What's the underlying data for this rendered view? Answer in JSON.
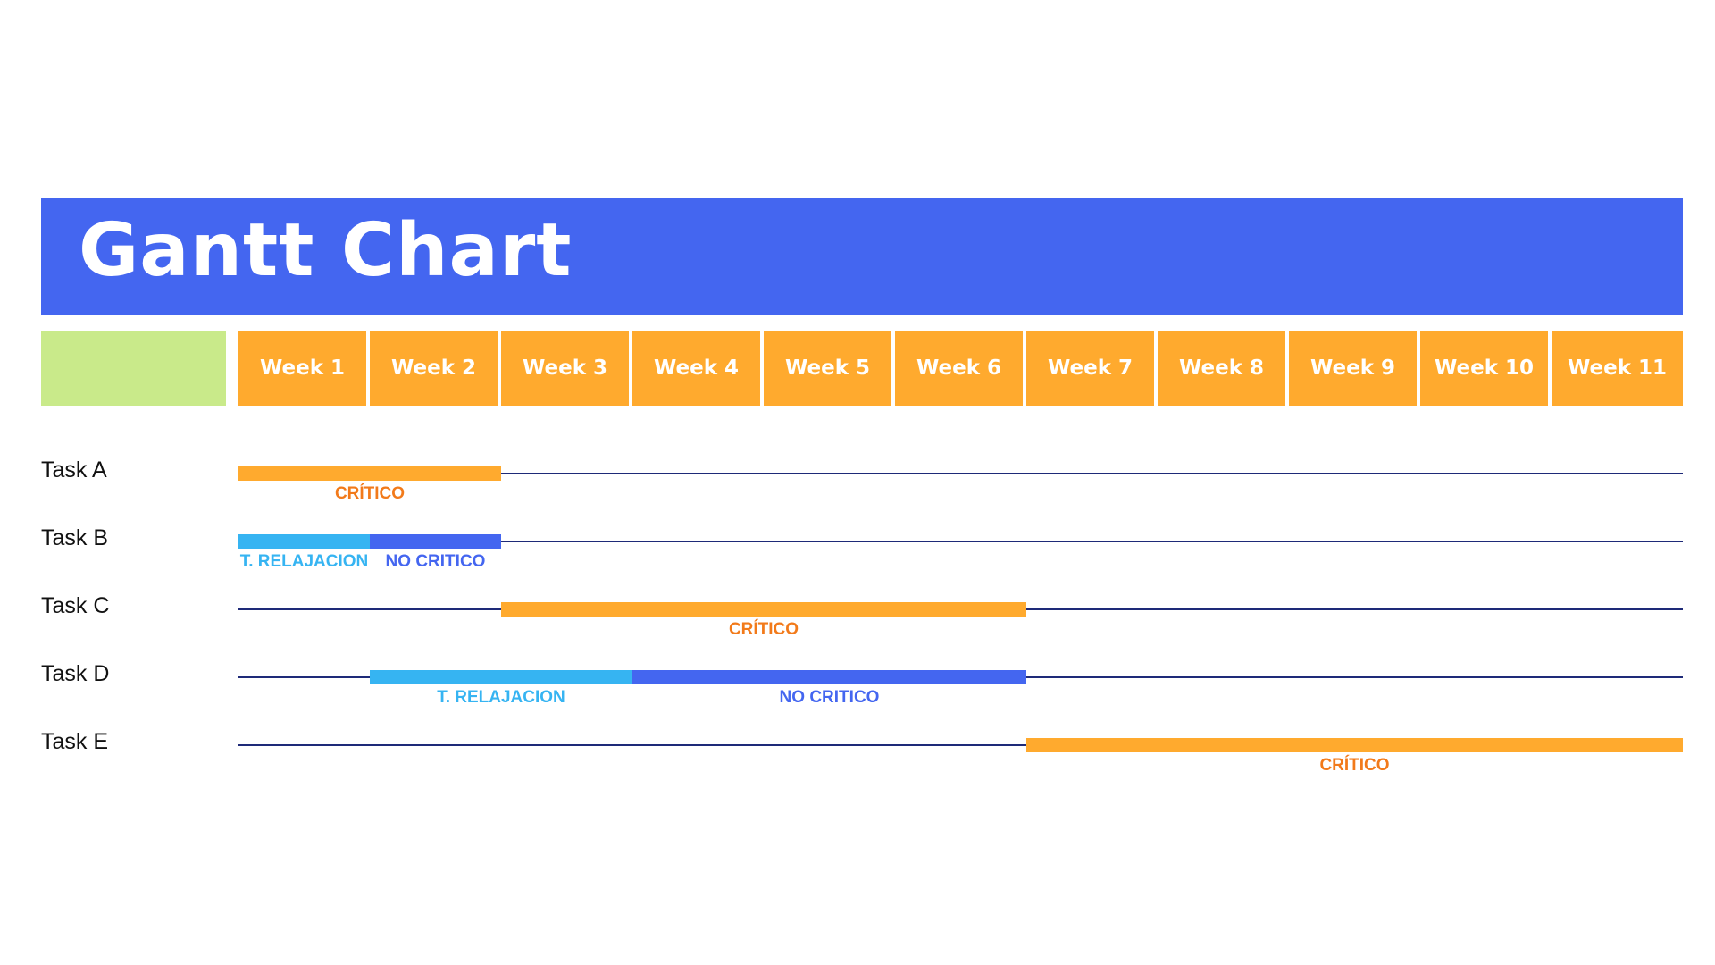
{
  "title": "Gantt Chart",
  "colors": {
    "title_bg": "#4466F0",
    "week_bg": "#FFAA2E",
    "corner_bg": "#C9EA8A",
    "critico": "#FFAA2E",
    "critico_text": "#F27A1A",
    "relajacion": "#36B4F2",
    "no_critico": "#4466F0",
    "timeline": "#1E2A78"
  },
  "chart_data": {
    "type": "gantt",
    "title": "Gantt Chart",
    "weeks": [
      "Week 1",
      "Week 2",
      "Week 3",
      "Week 4",
      "Week 5",
      "Week 6",
      "Week 7",
      "Week 8",
      "Week 9",
      "Week 10",
      "Week 11"
    ],
    "tasks": [
      {
        "name": "Task A",
        "segments": [
          {
            "start": 0,
            "end": 2,
            "kind": "critico",
            "label": "CRÍTICO"
          }
        ]
      },
      {
        "name": "Task B",
        "segments": [
          {
            "start": 0,
            "end": 1,
            "kind": "relajacion",
            "label": "T. RELAJACION"
          },
          {
            "start": 1,
            "end": 2,
            "kind": "no_critico",
            "label": "NO CRITICO"
          }
        ]
      },
      {
        "name": "Task C",
        "segments": [
          {
            "start": 2,
            "end": 6,
            "kind": "critico",
            "label": "CRÍTICO"
          }
        ]
      },
      {
        "name": "Task D",
        "segments": [
          {
            "start": 1,
            "end": 3,
            "kind": "relajacion",
            "label": "T. RELAJACION"
          },
          {
            "start": 3,
            "end": 6,
            "kind": "no_critico",
            "label": "NO CRITICO"
          }
        ]
      },
      {
        "name": "Task E",
        "segments": [
          {
            "start": 6,
            "end": 11,
            "kind": "critico",
            "label": "CRÍTICO"
          }
        ]
      }
    ]
  }
}
